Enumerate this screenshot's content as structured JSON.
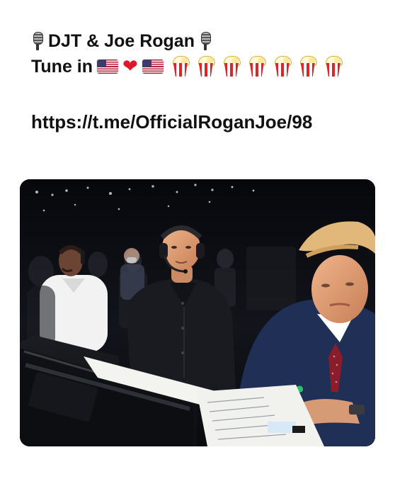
{
  "post": {
    "line1_text": "DJT & Joe Rogan",
    "line2_text": "Tune in",
    "link": "https://t.me/OfficialRoganJoe/98",
    "line1_icons": [
      "studio-microphone-icon",
      "studio-microphone-icon"
    ],
    "line2_icons": [
      "us-flag-icon",
      "red-heart-icon",
      "us-flag-icon",
      "popcorn-icon",
      "popcorn-icon",
      "popcorn-icon",
      "popcorn-icon",
      "popcorn-icon",
      "popcorn-icon",
      "popcorn-icon"
    ]
  },
  "media": {
    "kind": "photo",
    "colors": {
      "background": "#0b0c10",
      "suit_navy": "#1f2f56",
      "shirt_black": "#1a1b20",
      "shirt_white": "#f2f2f2",
      "skin": "#d69a74",
      "hair_blonde": "#e2b77a"
    }
  }
}
